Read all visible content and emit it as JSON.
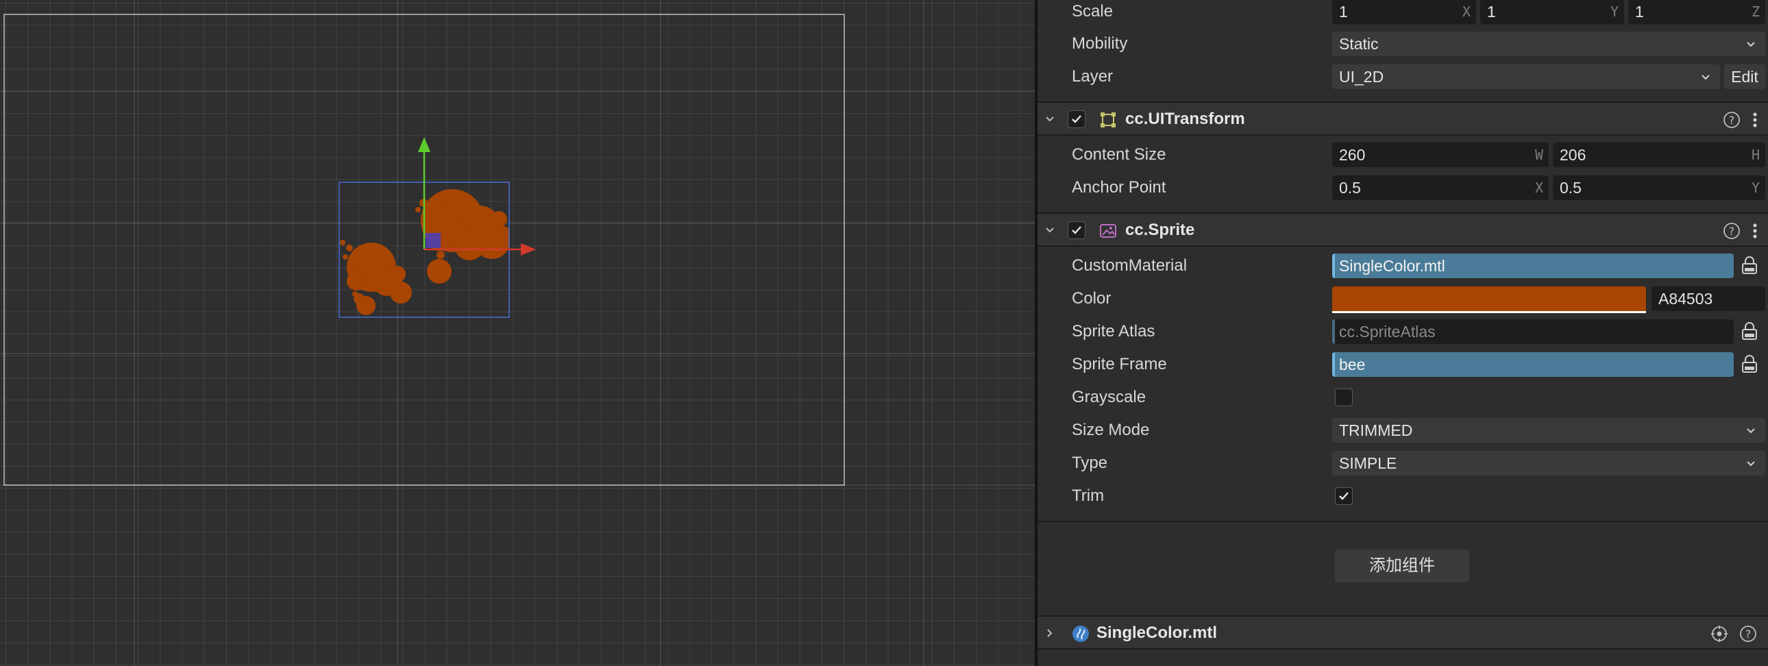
{
  "inspector": {
    "transform": {
      "scale_label": "Scale",
      "scale_x": "1",
      "scale_y": "1",
      "scale_z": "1",
      "axis_x": "X",
      "axis_y": "Y",
      "axis_z": "Z",
      "mobility_label": "Mobility",
      "mobility_value": "Static",
      "layer_label": "Layer",
      "layer_value": "UI_2D",
      "edit_label": "Edit"
    },
    "ui_transform": {
      "title": "cc.UITransform",
      "enabled": true,
      "content_size_label": "Content Size",
      "width": "260",
      "width_axis": "W",
      "height": "206",
      "height_axis": "H",
      "anchor_label": "Anchor Point",
      "anchor_x": "0.5",
      "anchor_x_axis": "X",
      "anchor_y": "0.5",
      "anchor_y_axis": "Y"
    },
    "sprite": {
      "title": "cc.Sprite",
      "enabled": true,
      "custom_material_label": "CustomMaterial",
      "custom_material_value": "SingleColor.mtl",
      "color_label": "Color",
      "color_hex": "A84503",
      "color_value": "#A84503",
      "sprite_atlas_label": "Sprite Atlas",
      "sprite_atlas_value": "cc.SpriteAtlas",
      "sprite_frame_label": "Sprite Frame",
      "sprite_frame_value": "bee",
      "grayscale_label": "Grayscale",
      "grayscale": false,
      "size_mode_label": "Size Mode",
      "size_mode_value": "TRIMMED",
      "type_label": "Type",
      "type_value": "SIMPLE",
      "trim_label": "Trim",
      "trim": true
    },
    "add_component_label": "添加组件",
    "material_asset": {
      "title": "SingleColor.mtl"
    }
  },
  "colors": {
    "sprite_tint": "#A84503",
    "asset_field": "#4a7b98",
    "gizmo_x": "#d23a2a",
    "gizmo_y": "#5fcc2e",
    "selection": "#4a6fd6"
  },
  "icons": [
    "chevron-down-icon",
    "chevron-right-icon",
    "checkbox-icon",
    "ui-transform-icon",
    "sprite-icon",
    "help-icon",
    "more-icon",
    "lock-icon",
    "material-icon",
    "target-icon"
  ]
}
